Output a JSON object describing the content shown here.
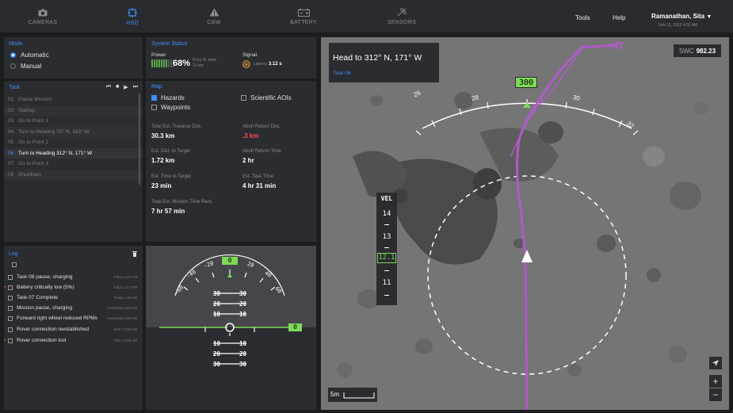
{
  "nav": {
    "items": [
      {
        "label": "CAMERAS",
        "icon": "camera-icon"
      },
      {
        "label": "HSD",
        "icon": "crosshair-icon"
      },
      {
        "label": "C&W",
        "icon": "warning-icon"
      },
      {
        "label": "BATTERY",
        "icon": "battery-icon"
      },
      {
        "label": "SENSORS",
        "icon": "signal-icon"
      }
    ],
    "active": "HSD",
    "tools_label": "Tools",
    "help_label": "Help",
    "user_name": "Ramanathan, Sita",
    "user_date": "Feb 12, 2022 4:52 AM"
  },
  "mode": {
    "title": "Mode",
    "options": [
      "Automatic",
      "Manual"
    ],
    "selected": "Automatic"
  },
  "system_status": {
    "title": "System Status",
    "power_label": "Power",
    "power_percent": "68%",
    "power_level": 0.68,
    "power_time": "8 hrs 21 mins",
    "power_dist": "23 km",
    "signal_label": "Signal",
    "latency_label": "Latency",
    "latency_value": "3.12 s"
  },
  "task": {
    "title": "Task",
    "items": [
      {
        "num": "01",
        "label": "Pause Mission"
      },
      {
        "num": "02",
        "label": "Startup"
      },
      {
        "num": "03",
        "label": "Go to Point 1"
      },
      {
        "num": "04",
        "label": "Turn to Heading 70° N, 163° W"
      },
      {
        "num": "05",
        "label": "Go to Point 2"
      },
      {
        "num": "06",
        "label": "Turn to Heading 312° N, 171° W"
      },
      {
        "num": "07",
        "label": "Go to Point 3"
      },
      {
        "num": "08",
        "label": "Shutdown"
      }
    ],
    "current": "06"
  },
  "map_panel": {
    "title": "Map",
    "hazards": "Hazards",
    "waypoints": "Waypoints",
    "scientific": "Scientific AOIs",
    "hazards_checked": true,
    "waypoints_checked": false,
    "scientific_checked": false,
    "stats": [
      {
        "label": "Total Est. Traverse Dist.",
        "value": "30.3 km"
      },
      {
        "label": "Abort Return Dist.",
        "value": ".3 km",
        "color": "#ff4d4d"
      },
      {
        "label": "Est. Dist. to Target",
        "value": "1.72 km"
      },
      {
        "label": "Abort Return Time",
        "value": "2 hr"
      },
      {
        "label": "Est. Time to Target",
        "value": "23 min"
      },
      {
        "label": "Est. Task Time",
        "value": "4 hr 31 min"
      },
      {
        "label": "Total Est. Mission Time Rem.",
        "value": "7 hr 57 min"
      }
    ]
  },
  "log": {
    "title": "Log",
    "items": [
      {
        "label": "Task 08 pause, charging",
        "time": "Today 2:01 PM",
        "flag": false
      },
      {
        "label": "Battery critically low (5%)",
        "time": "Today 2:17 PM",
        "flag": true
      },
      {
        "label": "Task 07 Complete",
        "time": "Today 1:44 AM",
        "flag": false
      },
      {
        "label": "Mission pause, charging",
        "time": "Yesterday 6:25 PM",
        "flag": false
      },
      {
        "label": "Forward right wheel reduced RPMs",
        "time": "Yesterday 6:30 PM",
        "flag": false
      },
      {
        "label": "Rover connection reestablished",
        "time": "Feb 2 7:36 PM",
        "flag": false
      },
      {
        "label": "Rover connection lost",
        "time": "Feb 1 4:53 AM",
        "flag": true
      }
    ]
  },
  "attitude": {
    "heading_value": "0",
    "ticks": [
      "-60",
      "-40",
      "-20",
      "20",
      "40",
      "60"
    ],
    "pitch_up": [
      "30",
      "20",
      "10"
    ],
    "pitch_down": [
      "10",
      "20",
      "30"
    ],
    "roll_value": "0"
  },
  "map": {
    "heading_title": "Head to 312° N, 171° W",
    "task_link": "Task 06",
    "swc_label": "SWC",
    "swc_value": "982.23",
    "heading_box": "300",
    "compass_ticks": [
      "26",
      "28",
      "30",
      "32"
    ],
    "vel_label": "VEL",
    "vel_values": [
      "14",
      "13",
      "12.1",
      "11"
    ],
    "scale_label": "5m",
    "colors": {
      "path": "#b05ac8",
      "accent": "#7ed957",
      "link": "#3e8ef7"
    }
  }
}
